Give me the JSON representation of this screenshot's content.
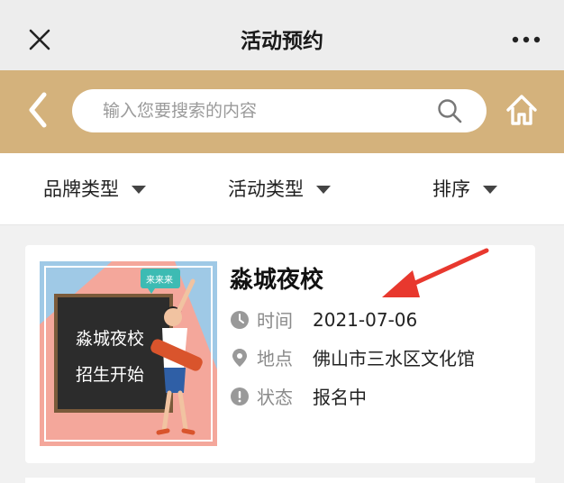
{
  "titlebar": {
    "title": "活动预约"
  },
  "search": {
    "placeholder": "输入您要搜索的内容"
  },
  "filters": [
    {
      "label": "品牌类型"
    },
    {
      "label": "活动类型"
    },
    {
      "label": "排序"
    }
  ],
  "activity": {
    "title": "淼城夜校",
    "time_label": "时间",
    "time_value": "2021-07-06",
    "place_label": "地点",
    "place_value": "佛山市三水区文化馆",
    "status_label": "状态",
    "status_value": "报名中",
    "image": {
      "board_text_line1": "淼城夜校",
      "board_text_line2": "招生开始",
      "bubble_text": "来来来"
    }
  },
  "colors": {
    "accent": "#d4b27c",
    "arrow": "#e8382e"
  },
  "icons": {
    "close": "close-icon",
    "more": "more-icon",
    "back": "chevron-left-icon",
    "search": "search-icon",
    "home": "home-icon",
    "clock": "clock-icon",
    "location": "location-pin-icon",
    "status": "exclamation-circle-icon"
  }
}
